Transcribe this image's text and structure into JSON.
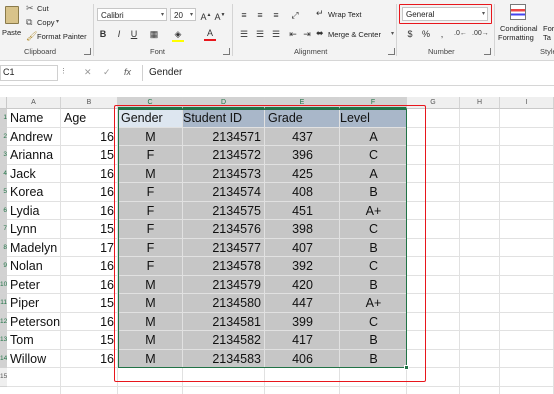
{
  "ribbon": {
    "clipboard": {
      "paste": "Paste",
      "cut": "Cut",
      "copy": "Copy",
      "format_painter": "Format Painter",
      "label": "Clipboard"
    },
    "font": {
      "name": "Calibri",
      "size": "20",
      "label": "Font",
      "bold": "B",
      "italic": "I",
      "underline": "U"
    },
    "alignment": {
      "wrap_text": "Wrap Text",
      "merge_center": "Merge & Center",
      "label": "Alignment"
    },
    "number": {
      "format": "General",
      "label": "Number",
      "currency": "$",
      "percent": "%",
      "comma": ","
    },
    "styles": {
      "conditional_line1": "Conditional",
      "conditional_line2": "Formatting",
      "format_as_line1": "For",
      "format_as_line2": "Ta",
      "label": "Style"
    }
  },
  "formula_bar": {
    "name_box": "C1",
    "fx": "fx",
    "content": "Gender"
  },
  "columns": [
    "A",
    "B",
    "C",
    "D",
    "E",
    "F",
    "G",
    "H",
    "I"
  ],
  "rows": [
    "1",
    "2",
    "3",
    "4",
    "5",
    "6",
    "7",
    "8",
    "9",
    "10",
    "11",
    "12",
    "13",
    "14",
    "15"
  ],
  "table": {
    "headers": [
      "Name",
      "Age",
      "Gender",
      "Student ID",
      "Grade",
      "Level"
    ],
    "data": [
      [
        "Andrew",
        "16",
        "M",
        "2134571",
        "437",
        "A"
      ],
      [
        "Arianna",
        "15",
        "F",
        "2134572",
        "396",
        "C"
      ],
      [
        "Jack",
        "16",
        "M",
        "2134573",
        "425",
        "A"
      ],
      [
        "Korea",
        "16",
        "F",
        "2134574",
        "408",
        "B"
      ],
      [
        "Lydia",
        "16",
        "F",
        "2134575",
        "451",
        "A+"
      ],
      [
        "Lynn",
        "15",
        "F",
        "2134576",
        "398",
        "C"
      ],
      [
        "Madelyn",
        "17",
        "F",
        "2134577",
        "407",
        "B"
      ],
      [
        "Nolan",
        "16",
        "F",
        "2134578",
        "392",
        "C"
      ],
      [
        "Peter",
        "16",
        "M",
        "2134579",
        "420",
        "B"
      ],
      [
        "Piper",
        "15",
        "M",
        "2134580",
        "447",
        "A+"
      ],
      [
        "Peterson",
        "16",
        "M",
        "2134581",
        "399",
        "C"
      ],
      [
        "Tom",
        "15",
        "M",
        "2134582",
        "417",
        "B"
      ],
      [
        "Willow",
        "16",
        "M",
        "2134583",
        "406",
        "B"
      ]
    ]
  },
  "colors": {
    "selection_fill": "#c6c6c6",
    "header_fill": "#a9b7c9",
    "annotation_red": "#e8161c",
    "selection_border": "#217346"
  }
}
